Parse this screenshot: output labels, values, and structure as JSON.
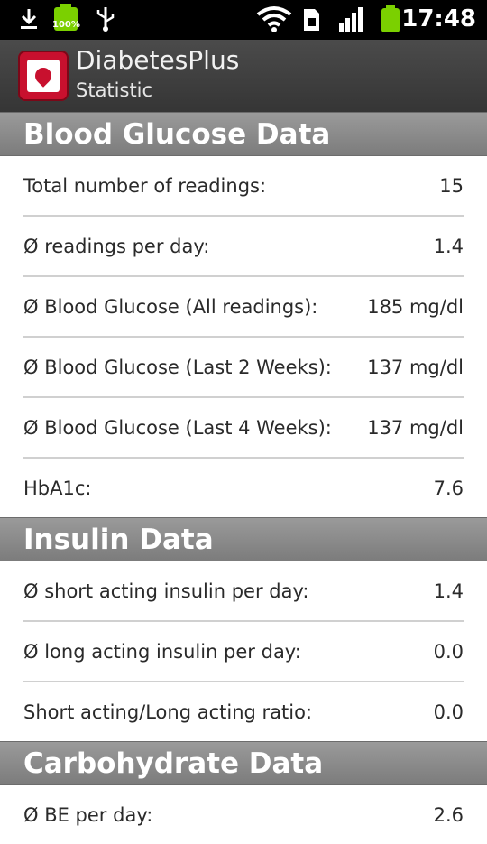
{
  "status_bar": {
    "battery_left_text": "100%",
    "time": "17:48",
    "icons": [
      "download-icon",
      "battery-full-icon",
      "usb-icon",
      "wifi-icon",
      "sim-card-icon",
      "signal-bars-icon",
      "battery-icon"
    ]
  },
  "action_bar": {
    "app_name": "DiabetesPlus",
    "subtitle": "Statistic"
  },
  "sections": {
    "blood_glucose": {
      "title": "Blood Glucose Data",
      "rows": [
        {
          "label": "Total number of readings:",
          "value": "15"
        },
        {
          "label": "Ø readings per day:",
          "value": "1.4"
        },
        {
          "label": "Ø Blood Glucose (All readings):",
          "value": "185 mg/dl"
        },
        {
          "label": "Ø Blood Glucose (Last 2 Weeks):",
          "value": "137 mg/dl"
        },
        {
          "label": "Ø Blood Glucose (Last 4 Weeks):",
          "value": "137 mg/dl"
        },
        {
          "label": "HbA1c:",
          "value": "7.6"
        }
      ]
    },
    "insulin": {
      "title": "Insulin Data",
      "rows": [
        {
          "label": "Ø short acting insulin per day:",
          "value": "1.4"
        },
        {
          "label": "Ø long acting insulin per day:",
          "value": "0.0"
        },
        {
          "label": "Short acting/Long acting ratio:",
          "value": "0.0"
        }
      ]
    },
    "carbohydrate": {
      "title": "Carbohydrate Data",
      "rows": [
        {
          "label": "Ø BE per day:",
          "value": "2.6"
        }
      ]
    }
  },
  "colors": {
    "status_bar_bg": "#000000",
    "action_bar_bg": "#3f3f3f",
    "section_header_bg": "#8a8a8a",
    "accent_red": "#c8102e",
    "battery_green": "#7bd000"
  }
}
